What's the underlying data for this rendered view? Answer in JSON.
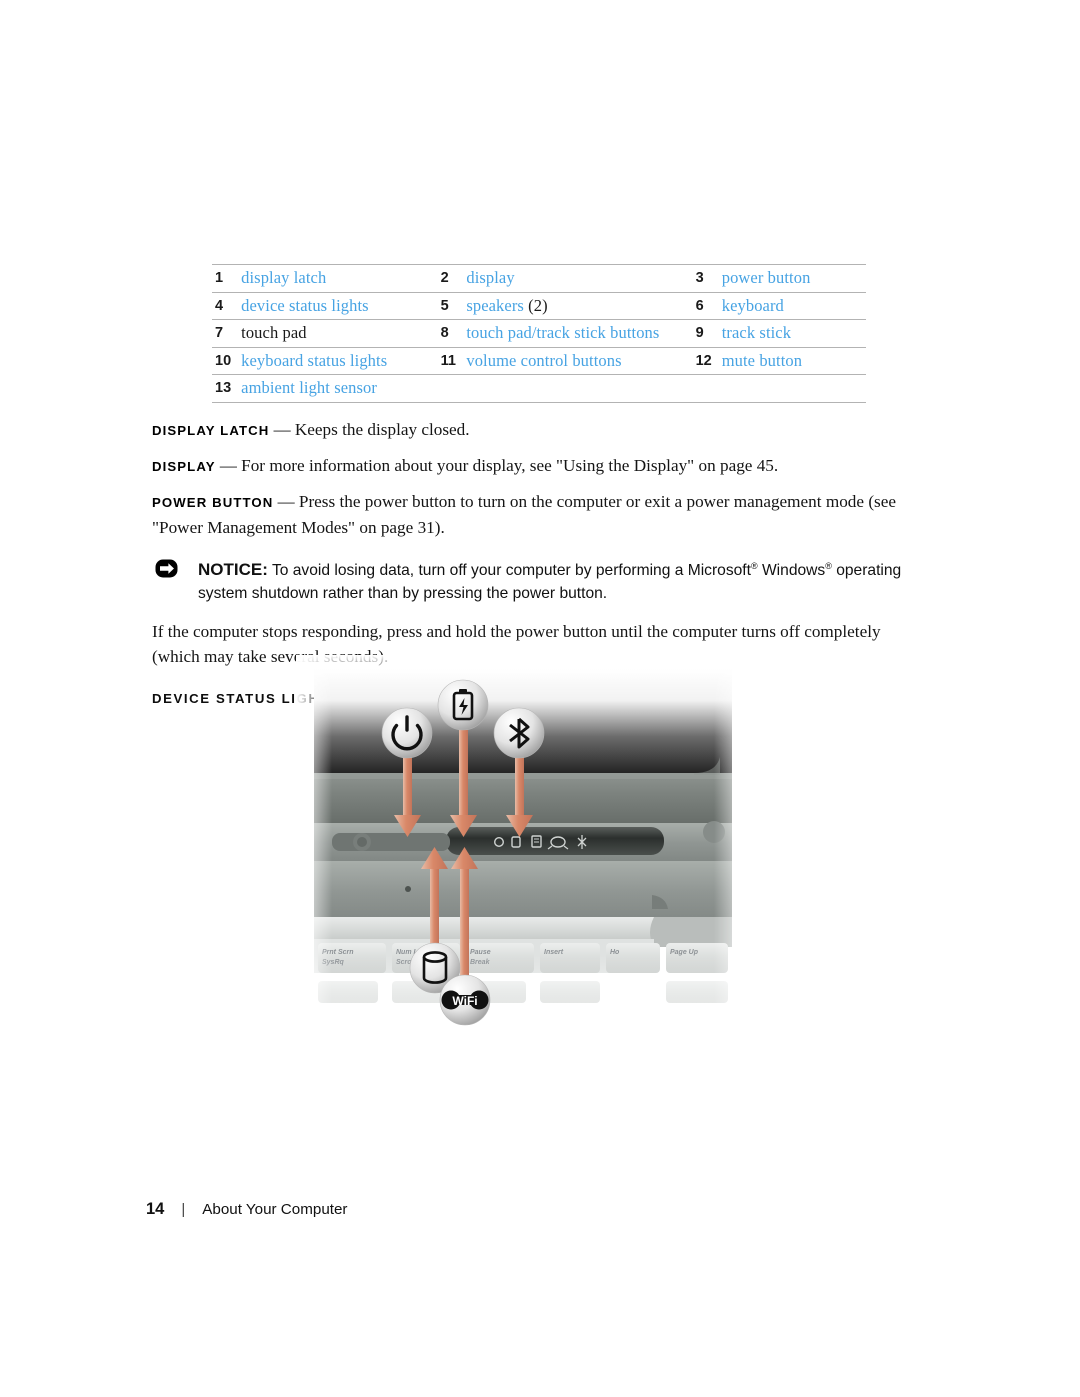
{
  "callout_table": {
    "rows": [
      [
        {
          "num": "1",
          "label": "display latch",
          "link": true
        },
        {
          "num": "2",
          "label": "display",
          "link": true
        },
        {
          "num": "3",
          "label": "power button",
          "link": true
        }
      ],
      [
        {
          "num": "4",
          "label": "device status lights",
          "link": true
        },
        {
          "num": "5",
          "label": "speakers",
          "suffix": " (2)",
          "link": true
        },
        {
          "num": "6",
          "label": "keyboard",
          "link": true
        }
      ],
      [
        {
          "num": "7",
          "label": "touch pad",
          "link": false
        },
        {
          "num": "8",
          "label": "touch pad/track stick buttons",
          "link": true
        },
        {
          "num": "9",
          "label": "track stick",
          "link": true
        }
      ],
      [
        {
          "num": "10",
          "label": "keyboard status lights",
          "link": true
        },
        {
          "num": "11",
          "label": "volume control buttons",
          "link": true
        },
        {
          "num": "12",
          "label": "mute button",
          "link": true
        }
      ],
      [
        {
          "num": "13",
          "label": "ambient light sensor",
          "link": true
        },
        {
          "num": "",
          "label": "",
          "link": false
        },
        {
          "num": "",
          "label": "",
          "link": false
        }
      ]
    ]
  },
  "definitions": [
    {
      "term": "DISPLAY LATCH",
      "dash": "—",
      "text": "Keeps the display closed."
    },
    {
      "term": "DISPLAY",
      "dash": "—",
      "text": "For more information about your display, see \"Using the Display\" on page 45."
    },
    {
      "term": "POWER BUTTON",
      "dash": "—",
      "text": "Press the power button to turn on the computer or exit a power management mode (see \"Power Management Modes\" on page 31)."
    }
  ],
  "notice": {
    "icon": "notice-arrow-icon",
    "word": "NOTICE:",
    "text_part1": "To avoid losing data, turn off your computer by performing a Microsoft",
    "reg1": "®",
    "text_part2": " Windows",
    "reg2": "®",
    "text_part3": " operating system shutdown rather than by pressing the power button."
  },
  "after_notice_paragraph": "If the computer stops responding, press and hold the power button until the computer turns off completely (which may take several seconds).",
  "section_heading": "DEVICE STATUS LIGHTS",
  "figure": {
    "alt": "laptop device status lights callout illustration",
    "callout_icons": [
      {
        "name": "power-status-icon",
        "symbol": "power"
      },
      {
        "name": "battery-status-icon",
        "symbol": "battery"
      },
      {
        "name": "bluetooth-status-icon",
        "symbol": "bluetooth"
      },
      {
        "name": "hard-drive-status-icon",
        "symbol": "harddrive"
      },
      {
        "name": "wifi-status-icon",
        "symbol": "wifi",
        "text": "WiFi"
      }
    ],
    "keyboard_keys": [
      {
        "top": "Prnt Scrn",
        "bottom": "SysRq"
      },
      {
        "top": "Num Lk",
        "bottom": "Scroll Lk"
      },
      {
        "top": "Pause",
        "bottom": "Break"
      },
      {
        "top": "Insert",
        "bottom": ""
      },
      {
        "top": "Ho",
        "bottom": ""
      },
      {
        "top": "Page Up",
        "bottom": ""
      }
    ],
    "arrow_color": "#d98868"
  },
  "footer": {
    "page_number": "14",
    "separator": "|",
    "section": "About Your Computer"
  },
  "colors": {
    "link_blue": "#47a3e3",
    "rule_gray": "#b3b3b3",
    "text_black": "#151515",
    "arrow_orange": "#d98868"
  }
}
